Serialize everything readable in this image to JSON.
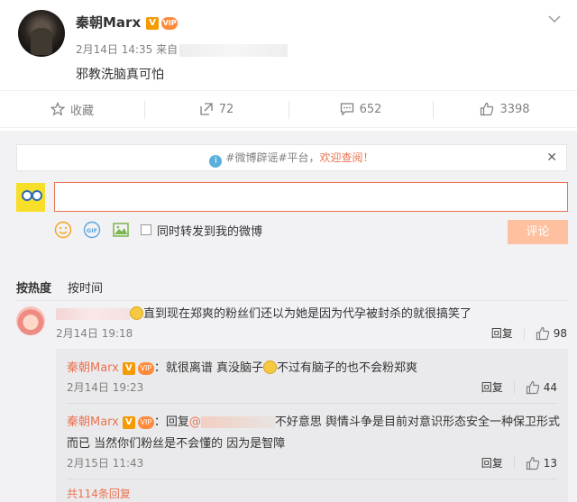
{
  "post": {
    "author": "秦朝Marx",
    "verified_badge": "V",
    "vip_badge": "VIP",
    "date": "2月14日 14:35",
    "source_prefix": "来自",
    "text": "邪教洗脑真可怕"
  },
  "actions": {
    "favorite": "收藏",
    "repost_count": "72",
    "comment_count": "652",
    "like_count": "3398"
  },
  "notice": {
    "prefix": "#微博辟谣#平台，",
    "highlight": "欢迎查阅！",
    "close": "✕"
  },
  "composer": {
    "input_value": "",
    "sync_label": "同时转发到我的微博",
    "submit_label": "评论"
  },
  "sort": {
    "by_hot": "按热度",
    "by_time": "按时间"
  },
  "comment": {
    "text": "直到现在郑爽的粉丝们还以为她是因为代孕被封杀的就很搞笑了",
    "time": "2月14日 19:18",
    "reply_label": "回复",
    "likes": "98"
  },
  "replies": [
    {
      "author": "秦朝Marx",
      "text_a": "：就很离谱 真没脑子",
      "text_b": "不过有脑子的也不会粉郑爽",
      "time": "2月14日 19:23",
      "reply_label": "回复",
      "likes": "44"
    },
    {
      "author": "秦朝Marx",
      "prefix": "：回复",
      "mention": "@",
      "text_a": "不好意思 舆情斗争是目前对意识形态安全一种保卫形式",
      "text_b": "而已 当然你们粉丝是不会懂的 因为是智障",
      "time": "2月15日 11:43",
      "reply_label": "回复",
      "likes": "13"
    }
  ],
  "more_replies": "共114条回复",
  "colors": {
    "accent": "#eb7350",
    "panel": "#f2f2f5",
    "reply_bg": "#eaeaec",
    "submit_disabled": "#ffc09f"
  }
}
